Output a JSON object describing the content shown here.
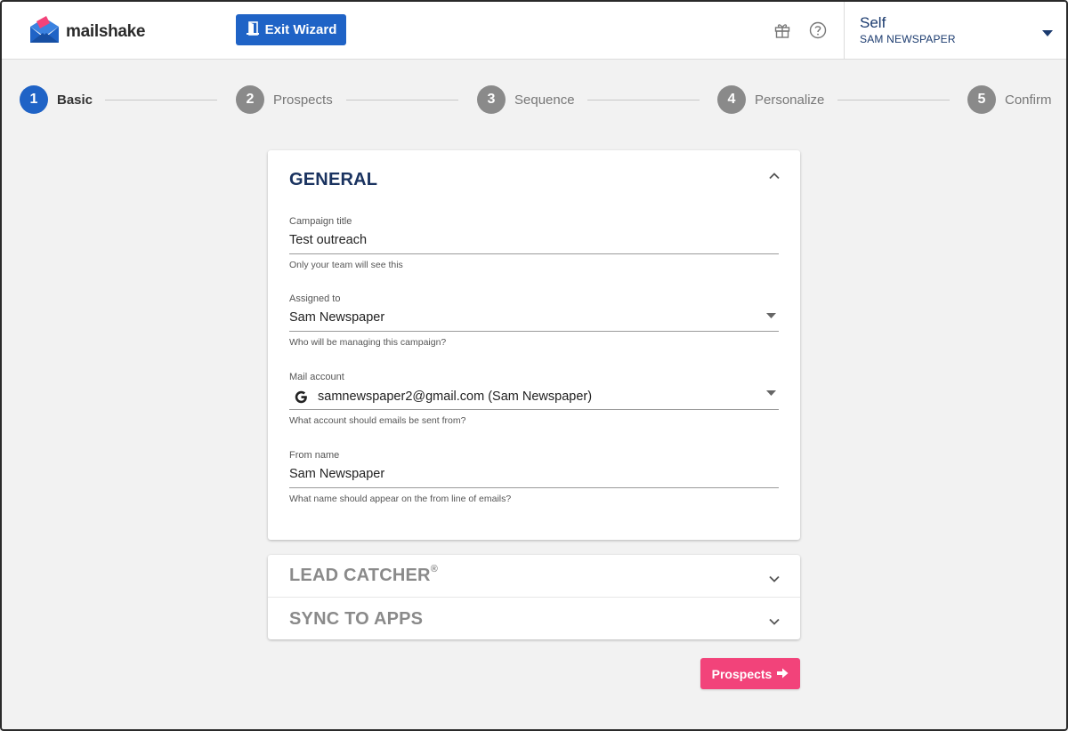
{
  "header": {
    "brand": "mailshake",
    "exit_label": "Exit Wizard",
    "account": {
      "name": "Self",
      "sub": "SAM NEWSPAPER"
    }
  },
  "steps": [
    {
      "num": "1",
      "label": "Basic",
      "active": true
    },
    {
      "num": "2",
      "label": "Prospects",
      "active": false
    },
    {
      "num": "3",
      "label": "Sequence",
      "active": false
    },
    {
      "num": "4",
      "label": "Personalize",
      "active": false
    },
    {
      "num": "5",
      "label": "Confirm",
      "active": false
    }
  ],
  "general": {
    "title": "GENERAL",
    "fields": {
      "campaign_title": {
        "label": "Campaign title",
        "value": "Test outreach",
        "help": "Only your team will see this"
      },
      "assigned_to": {
        "label": "Assigned to",
        "value": "Sam Newspaper",
        "help": "Who will be managing this campaign?"
      },
      "mail_account": {
        "label": "Mail account",
        "value": "samnewspaper2@gmail.com (Sam Newspaper)",
        "help": "What account should emails be sent from?"
      },
      "from_name": {
        "label": "From name",
        "value": "Sam Newspaper",
        "help": "What name should appear on the from line of emails?"
      }
    }
  },
  "sections": {
    "lead_catcher": {
      "title": "LEAD CATCHER",
      "mark": "®"
    },
    "sync_to_apps": {
      "title": "SYNC TO APPS"
    }
  },
  "next_button": {
    "label": "Prospects"
  },
  "colors": {
    "primary": "#1f63c6",
    "accent": "#f2437a",
    "heading": "#1a3360"
  }
}
